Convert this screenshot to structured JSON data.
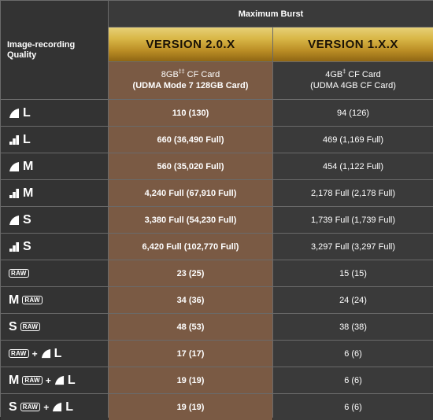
{
  "header": {
    "quality_title": "Image-recording Quality",
    "burst_title": "Maximum Burst",
    "version_a": "VERSION 2.0.X",
    "version_b": "VERSION 1.X.X",
    "card_a_line1_pre": "8GB",
    "card_a_line1_sup": "‡‡",
    "card_a_line1_post": " CF Card",
    "card_a_line2": "(UDMA Mode 7 128GB Card)",
    "card_b_line1_pre": "4GB",
    "card_b_line1_sup": "‡",
    "card_b_line1_post": " CF Card",
    "card_b_line2": "(UDMA 4GB CF Card)"
  },
  "rows": [
    {
      "q": "L",
      "icon": "fine",
      "a": "110 (130)",
      "b": "94 (126)"
    },
    {
      "q": "L",
      "icon": "normal",
      "a": "660 (36,490 Full)",
      "b": "469 (1,169 Full)"
    },
    {
      "q": "M",
      "icon": "fine",
      "a": "560 (35,020 Full)",
      "b": "454 (1,122 Full)"
    },
    {
      "q": "M",
      "icon": "normal",
      "a": "4,240 Full (67,910 Full)",
      "b": "2,178 Full (2,178 Full)"
    },
    {
      "q": "S",
      "icon": "fine",
      "a": "3,380 Full (54,230 Full)",
      "b": "1,739 Full (1,739 Full)"
    },
    {
      "q": "S",
      "icon": "normal",
      "a": "6,420 Full (102,770 Full)",
      "b": "3,297 Full (3,297 Full)"
    },
    {
      "q": "RAW",
      "a": "23 (25)",
      "b": "15 (15)"
    },
    {
      "q": "M RAW",
      "a": "34 (36)",
      "b": "24 (24)"
    },
    {
      "q": "S RAW",
      "a": "48 (53)",
      "b": "38 (38)"
    },
    {
      "q": "RAW + L",
      "a": "17 (17)",
      "b": "6 (6)"
    },
    {
      "q": "M RAW + L",
      "a": "19 (19)",
      "b": "6 (6)"
    },
    {
      "q": "S RAW + L",
      "a": "19 (19)",
      "b": "6 (6)"
    }
  ],
  "labels": {
    "L": "L",
    "M": "M",
    "S": "S",
    "raw": "RAW",
    "plus": "+"
  },
  "colors": {
    "version_a_column": "#7a5a44",
    "gold_header": "#d8b646",
    "background": "#333333"
  }
}
